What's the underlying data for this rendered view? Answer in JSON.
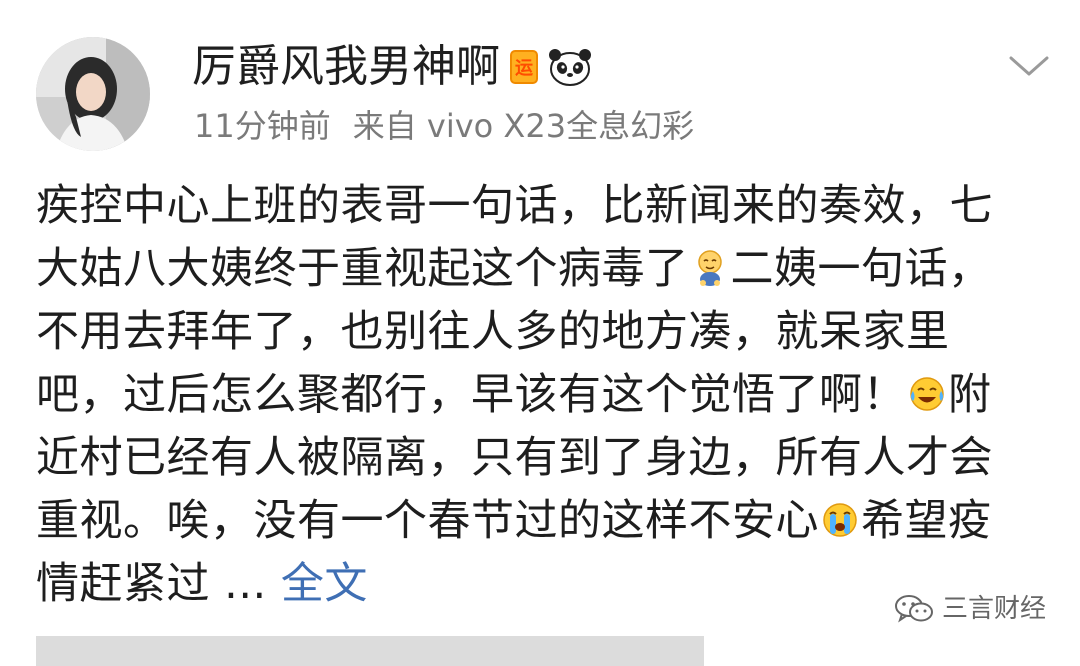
{
  "post": {
    "username": "厉爵风我男神啊",
    "badge": "运",
    "time": "11分钟前",
    "source": "来自 vivo X23全息幻彩",
    "lines": [
      {
        "parts": [
          {
            "text": "疾控中心上班的表哥一句话，比新闻来的奏效，七"
          }
        ]
      },
      {
        "parts": [
          {
            "text": "大姑八大姨终于重视起这个病毒了"
          },
          {
            "emoji": "dizzy-baby-emoji"
          },
          {
            "text": "二姨一句话，"
          }
        ]
      },
      {
        "parts": [
          {
            "text": "不用去拜年了，也别往人多的地方凑，就呆家里"
          }
        ]
      },
      {
        "parts": [
          {
            "text": "吧，过后怎么聚都行，早该有这个觉悟了啊！"
          },
          {
            "emoji": "laugh-cry-emoji"
          },
          {
            "text": "附"
          }
        ]
      },
      {
        "parts": [
          {
            "text": "近村已经有人被隔离，只有到了身边，所有人才会"
          }
        ]
      },
      {
        "parts": [
          {
            "text": "重视。唉，没有一个春节过的这样不安心"
          },
          {
            "emoji": "crying-emoji"
          },
          {
            "text": "希望疫"
          }
        ]
      },
      {
        "parts": [
          {
            "text": "情赶紧过 ... "
          },
          {
            "link": "全文"
          }
        ]
      }
    ]
  },
  "watermark": {
    "text": "三言财经"
  },
  "colors": {
    "link": "#3f6fb4",
    "meta": "#7a7a7a",
    "text": "#1e1e1e"
  }
}
